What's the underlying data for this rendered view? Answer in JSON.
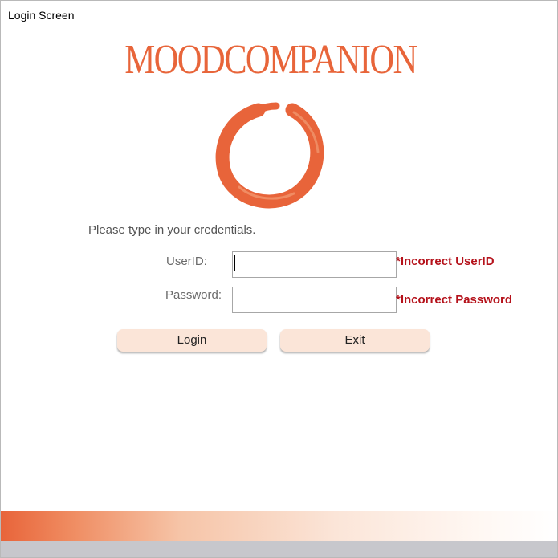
{
  "window": {
    "title": "Login Screen"
  },
  "brand": {
    "name": "MOODCOMPANION",
    "logo_icon": "orange-brush-circle-icon",
    "accent_color": "#e8653a"
  },
  "form": {
    "prompt": "Please type in your credentials.",
    "userid_label": "UserID:",
    "userid_value": "",
    "password_label": "Password:",
    "password_value": "",
    "userid_error": "*Incorrect UserID",
    "password_error": "*Incorrect Password",
    "error_color": "#b5121b"
  },
  "actions": {
    "login_label": "Login",
    "exit_label": "Exit",
    "button_color": "#fbe5d8"
  }
}
